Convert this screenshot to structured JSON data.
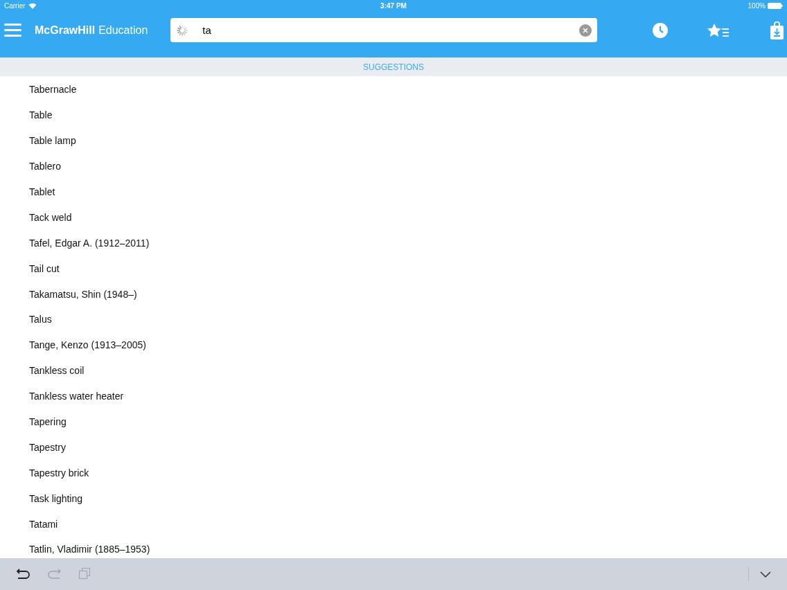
{
  "status_bar": {
    "carrier": "Carrier",
    "time": "3:47 PM",
    "battery": "100%"
  },
  "header": {
    "brand_bold": "McGrawHill",
    "brand_light": "Education",
    "search": {
      "value": "ta",
      "loading": true
    }
  },
  "suggestions": {
    "title": "SUGGESTIONS",
    "items": [
      "Tabernacle",
      "Table",
      "Table lamp",
      "Tablero",
      "Tablet",
      "Tack weld",
      "Tafel, Edgar A. (1912–2011)",
      "Tail cut",
      "Takamatsu, Shin (1948–)",
      "Talus",
      "Tange, Kenzo (1913–2005)",
      "Tankless coil",
      "Tankless water heater",
      "Tapering",
      "Tapestry",
      "Tapestry brick",
      "Task lighting",
      "Tatami",
      "Tatlin, Vladimir (1885–1953)"
    ]
  },
  "keyboard_toolbar": {
    "buttons": [
      {
        "kind": "undo",
        "disabled": false
      },
      {
        "kind": "redo",
        "disabled": true
      },
      {
        "kind": "paste",
        "disabled": true
      }
    ]
  }
}
